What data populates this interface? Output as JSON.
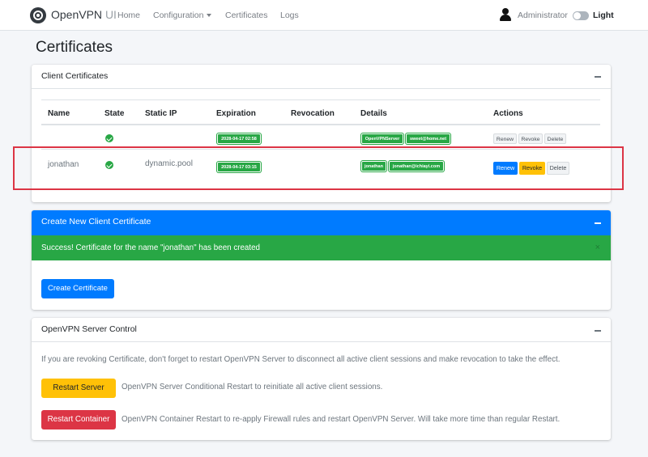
{
  "navbar": {
    "brand_name": "OpenVPN",
    "brand_suffix": "UI",
    "links": [
      "Home",
      "Configuration",
      "Certificates",
      "Logs"
    ],
    "user": "Administrator",
    "theme_label": "Light"
  },
  "page_title": "Certificates",
  "client_certificates": {
    "title": "Client Certificates",
    "headers": [
      "Name",
      "State",
      "Static IP",
      "Expiration",
      "Revocation",
      "Details",
      "Actions"
    ],
    "rows": [
      {
        "name": "",
        "static_ip": "",
        "expiration": "2028-04-17 02:58",
        "revocation": "",
        "details": [
          "OpenVPNServer",
          "sweet@home.net"
        ],
        "actions": [
          "Renew",
          "Revoke",
          "Delete"
        ]
      },
      {
        "name": "jonathan",
        "static_ip": "dynamic.pool",
        "expiration": "2028-04-17 03:15",
        "revocation": "",
        "details": [
          "jonathan",
          "jonathan@ichiayi.com"
        ],
        "actions": [
          "Renew",
          "Revoke",
          "Delete"
        ]
      }
    ]
  },
  "create_certificate": {
    "title": "Create New Client Certificate",
    "success_message": "Success! Certificate for the name \"jonathan\" has been created",
    "close_label": "×",
    "button_label": "Create Certificate"
  },
  "server_control": {
    "title": "OpenVPN Server Control",
    "note": "If you are revoking Certificate, don't forget to restart OpenVPN Server to disconnect all active client sessions and make revocation to take the effect.",
    "restart_server_label": "Restart Server",
    "restart_server_desc": "OpenVPN Server Conditional Restart to reinitiate all active client sessions.",
    "restart_container_label": "Restart Container",
    "restart_container_desc": "OpenVPN Container Restart to re-apply Firewall rules and restart OpenVPN Server. Will take more time than regular Restart."
  },
  "colors": {
    "primary": "#007bff",
    "success": "#28a745",
    "warning": "#ffc107",
    "danger": "#dc3545"
  }
}
